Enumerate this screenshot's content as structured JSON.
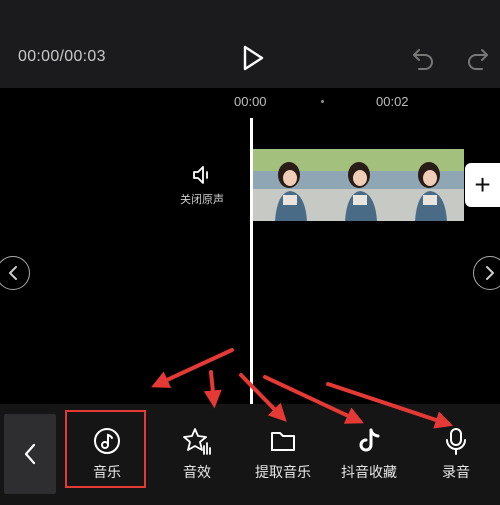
{
  "player": {
    "timecode": "00:00/00:03"
  },
  "ruler": {
    "label_0": "00:00",
    "label_1": "00:02"
  },
  "track": {
    "mute_label": "关闭原声",
    "add_label": "+"
  },
  "toolbar": {
    "items": [
      {
        "label": "音乐",
        "icon": "music-icon"
      },
      {
        "label": "音效",
        "icon": "sound-effect-icon"
      },
      {
        "label": "提取音乐",
        "icon": "folder-icon"
      },
      {
        "label": "抖音收藏",
        "icon": "tiktok-icon"
      },
      {
        "label": "录音",
        "icon": "microphone-icon"
      }
    ],
    "selected_index": 0
  },
  "colors": {
    "highlight": "#e53935",
    "annotation_arrow": "#e53935",
    "toolbar_bg": "#151515",
    "topbar_bg": "#1b1b1d"
  }
}
